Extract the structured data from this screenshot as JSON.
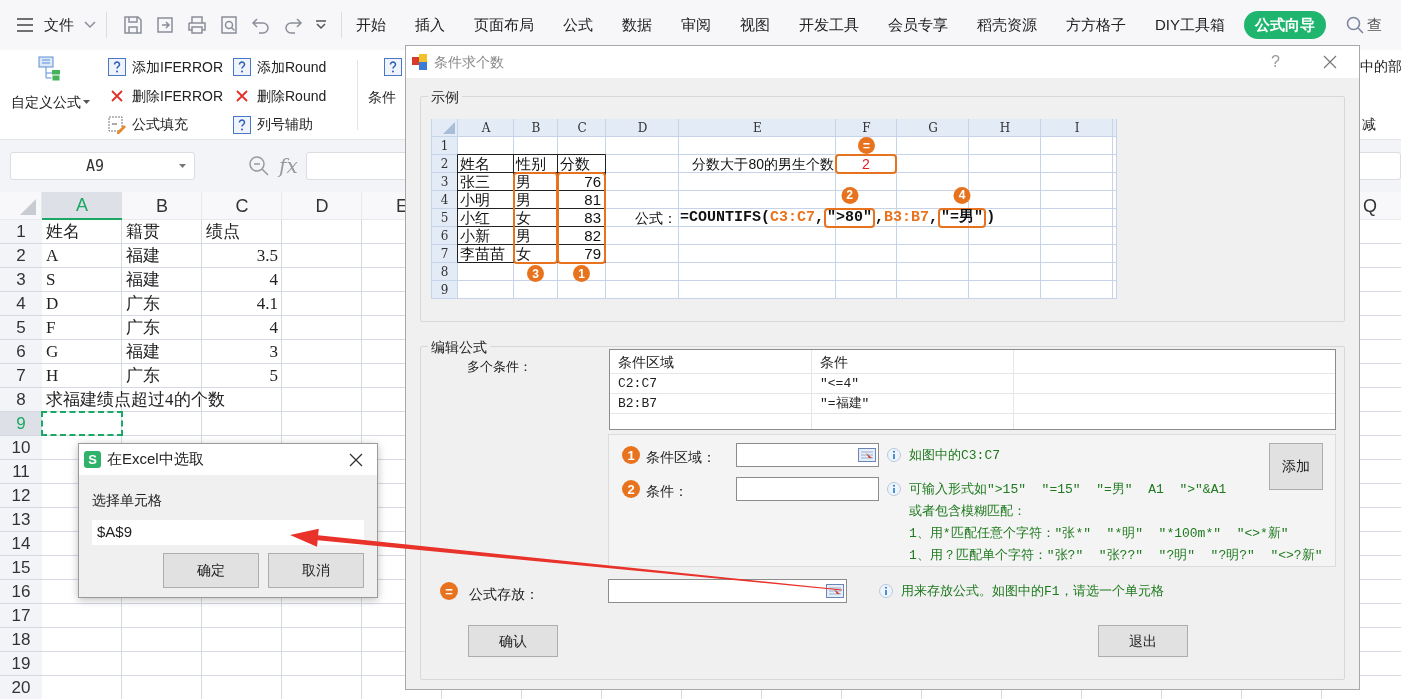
{
  "menu": {
    "file": "文件",
    "tabs": [
      {
        "label": "开始",
        "selected": false
      },
      {
        "label": "插入",
        "selected": false
      },
      {
        "label": "页面布局",
        "selected": false
      },
      {
        "label": "公式",
        "selected": false
      },
      {
        "label": "数据",
        "selected": false
      },
      {
        "label": "审阅",
        "selected": false
      },
      {
        "label": "视图",
        "selected": false
      },
      {
        "label": "开发工具",
        "selected": false
      },
      {
        "label": "会员专享",
        "selected": false
      },
      {
        "label": "稻壳资源",
        "selected": false
      },
      {
        "label": "方方格子",
        "selected": false
      },
      {
        "label": "DIY工具箱",
        "selected": false
      },
      {
        "label": "公式向导",
        "selected": true
      }
    ],
    "search": "查"
  },
  "ribbon": {
    "main_button": "自定义公式",
    "commands": [
      {
        "label": "添加IFERROR",
        "kind": "help"
      },
      {
        "label": "删除IFERROR",
        "kind": "delete"
      },
      {
        "label": "公式填充",
        "kind": "fill"
      },
      {
        "label": "添加Round",
        "kind": "help"
      },
      {
        "label": "删除Round",
        "kind": "delete"
      },
      {
        "label": "列号辅助",
        "kind": "help"
      }
    ],
    "next_button": "条件",
    "side_texts": [
      "中的部",
      "减"
    ]
  },
  "formula_bar": {
    "name_box": "A9",
    "fx": "fx"
  },
  "sheet": {
    "columns": [
      {
        "label": "A",
        "selected": true
      },
      {
        "label": "B",
        "selected": false
      },
      {
        "label": "C",
        "selected": false
      },
      {
        "label": "D",
        "selected": false
      },
      {
        "label": "E",
        "selected": false
      }
    ],
    "far_columns": [
      {
        "label": "Q",
        "selected": false
      }
    ],
    "rows": [
      {
        "number": "1",
        "selected": false,
        "cells": [
          {
            "text": "姓名",
            "kind": "text"
          },
          {
            "text": "籍贯",
            "kind": "text"
          },
          {
            "text": "绩点",
            "kind": "text"
          }
        ]
      },
      {
        "number": "2",
        "selected": false,
        "cells": [
          {
            "text": "A",
            "kind": "text"
          },
          {
            "text": "福建",
            "kind": "text"
          },
          {
            "text": "3.5",
            "kind": "number"
          }
        ]
      },
      {
        "number": "3",
        "selected": false,
        "cells": [
          {
            "text": "S",
            "kind": "text"
          },
          {
            "text": "福建",
            "kind": "text"
          },
          {
            "text": "4",
            "kind": "number"
          }
        ]
      },
      {
        "number": "4",
        "selected": false,
        "cells": [
          {
            "text": "D",
            "kind": "text"
          },
          {
            "text": "广东",
            "kind": "text"
          },
          {
            "text": "4.1",
            "kind": "number"
          }
        ]
      },
      {
        "number": "5",
        "selected": false,
        "cells": [
          {
            "text": "F",
            "kind": "text"
          },
          {
            "text": "广东",
            "kind": "text"
          },
          {
            "text": "4",
            "kind": "number"
          }
        ]
      },
      {
        "number": "6",
        "selected": false,
        "cells": [
          {
            "text": "G",
            "kind": "text"
          },
          {
            "text": "福建",
            "kind": "text"
          },
          {
            "text": "3",
            "kind": "number"
          }
        ]
      },
      {
        "number": "7",
        "selected": false,
        "cells": [
          {
            "text": "H",
            "kind": "text"
          },
          {
            "text": "广东",
            "kind": "text"
          },
          {
            "text": "5",
            "kind": "number"
          }
        ]
      },
      {
        "number": "8",
        "selected": false,
        "cells": [
          {
            "text": "求福建绩点超过4的个数",
            "kind": "text"
          }
        ]
      },
      {
        "number": "9",
        "selected": true,
        "cells": []
      },
      {
        "number": "10",
        "selected": false,
        "cells": []
      },
      {
        "number": "11",
        "selected": false,
        "cells": []
      },
      {
        "number": "12",
        "selected": false,
        "cells": []
      },
      {
        "number": "13",
        "selected": false,
        "cells": []
      },
      {
        "number": "14",
        "selected": false,
        "cells": []
      },
      {
        "number": "15",
        "selected": false,
        "cells": []
      },
      {
        "number": "16",
        "selected": false,
        "cells": []
      },
      {
        "number": "17",
        "selected": false,
        "cells": []
      },
      {
        "number": "18",
        "selected": false,
        "cells": []
      },
      {
        "number": "19",
        "selected": false,
        "cells": []
      },
      {
        "number": "20",
        "selected": false,
        "cells": []
      }
    ]
  },
  "dialog": {
    "title": "条件求个数",
    "help": "?",
    "example_legend": "示例",
    "example": {
      "columns": [
        "A",
        "B",
        "C",
        "D",
        "E",
        "F",
        "G",
        "H",
        "I"
      ],
      "row_numbers": [
        "1",
        "2",
        "3",
        "4",
        "5",
        "6",
        "7",
        "8",
        "9"
      ],
      "table_header": [
        {
          "text": "姓名"
        },
        {
          "text": "性别",
          "badge": "3"
        },
        {
          "text": "分数",
          "badge": "1"
        }
      ],
      "table_rows": [
        [
          "张三",
          "男",
          "76"
        ],
        [
          "小明",
          "男",
          "81"
        ],
        [
          "小红",
          "女",
          "83"
        ],
        [
          "小新",
          "男",
          "82"
        ],
        [
          "李苗苗",
          "女",
          "79"
        ]
      ],
      "label": "分数大于80的男生个数",
      "result": {
        "value": "2",
        "badge": "="
      },
      "formula_label": "公式：",
      "formula": [
        {
          "text": "=COUNTIFS(",
          "kind": "plain"
        },
        {
          "text": "C3:C7",
          "kind": "range"
        },
        {
          "text": ",",
          "kind": "plain"
        },
        {
          "text": "″>80″",
          "kind": "boxed",
          "badge": "2"
        },
        {
          "text": ",",
          "kind": "plain"
        },
        {
          "text": "B3:B7",
          "kind": "range"
        },
        {
          "text": ",",
          "kind": "plain"
        },
        {
          "text": "″=男″",
          "kind": "boxed",
          "badge": "4"
        },
        {
          "text": ")",
          "kind": "plain"
        }
      ]
    },
    "edit_legend": "编辑公式",
    "conditions_label": "多个条件：",
    "conditions": {
      "columns": [
        "条件区域",
        "条件"
      ],
      "rows": [
        [
          "C2:C7",
          "″<=4″"
        ],
        [
          "B2:B7",
          "″=福建″"
        ]
      ]
    },
    "fields": [
      {
        "badge": "1",
        "label": "条件区域：",
        "picker": true,
        "hint": [
          "如图中的C3:C7"
        ]
      },
      {
        "badge": "2",
        "label": "条件：",
        "picker": false,
        "hint": [
          "可输入形式如″>15″  ″=15″  ″=男″  A1  ″>″&A1",
          "或者包含模糊匹配：",
          "1、用*匹配任意个字符：″张*″  ″*明″  ″*100m*″  ″<>*新″",
          "1、用？匹配单个字符：″张?″  ″张??″  ″?明″  ″?明?″  ″<>?新″"
        ]
      }
    ],
    "add_button": "添加",
    "target": {
      "badge": "=",
      "label": "公式存放：",
      "picker": true,
      "hint": "用来存放公式。如图中的F1，请选一个单元格"
    },
    "ok_button": "确认",
    "exit_button": "退出"
  },
  "picker": {
    "logo": "S",
    "title": "在Excel中选取",
    "label": "选择单元格",
    "value": "$A$9",
    "buttons": [
      "确定",
      "取消"
    ]
  }
}
